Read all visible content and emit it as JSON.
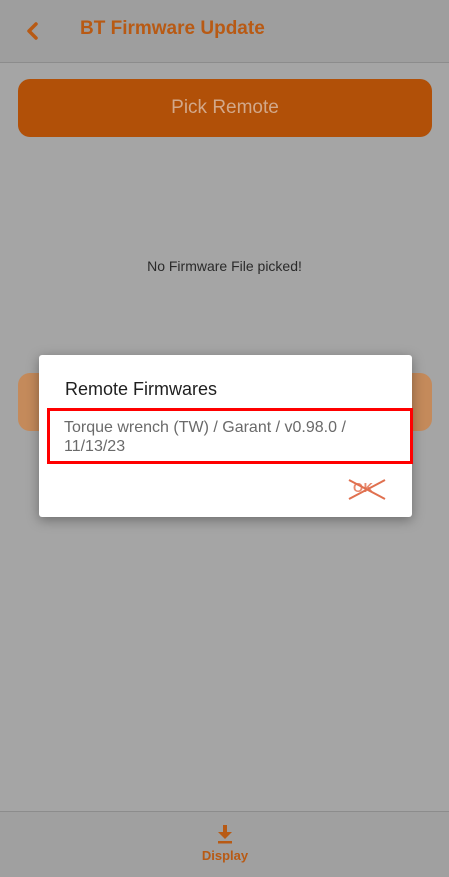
{
  "header": {
    "back_icon": "chevron-left-icon",
    "title": "BT Firmware Update"
  },
  "main": {
    "pick_remote_label": "Pick Remote",
    "status_text": "No Firmware File picked!"
  },
  "dialog": {
    "title": "Remote Firmwares",
    "items": [
      {
        "label": "Torque wrench (TW) / Garant / v0.98.0 / 11/13/23"
      }
    ],
    "ok_label": "OK"
  },
  "bottom_nav": {
    "display_label": "Display",
    "display_icon": "download-icon"
  },
  "colors": {
    "accent": "#b85a14",
    "button": "#b15008",
    "highlight": "#ff0000"
  }
}
